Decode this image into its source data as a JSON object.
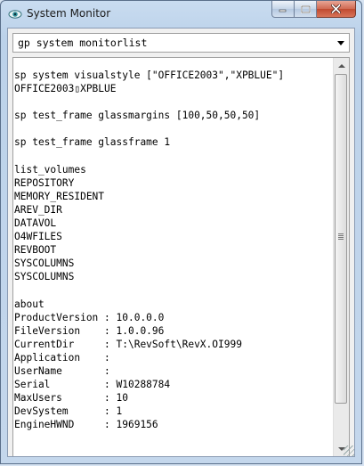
{
  "window": {
    "title": "System Monitor",
    "icon": "eye-icon"
  },
  "command": {
    "value": "gp system monitorlist"
  },
  "output": {
    "lines": [
      "sp system visualstyle [\"OFFICE2003\",\"XPBLUE\"]",
      "OFFICE2003▯XPBLUE",
      "",
      "sp test_frame glassmargins [100,50,50,50]",
      "",
      "sp test_frame glassframe 1",
      "",
      "list_volumes",
      "REPOSITORY",
      "MEMORY_RESIDENT",
      "AREV_DIR",
      "DATAVOL",
      "O4WFILES",
      "REVBOOT",
      "SYSCOLUMNS",
      "SYSCOLUMNS",
      "",
      "about",
      "ProductVersion : 10.0.0.0",
      "FileVersion    : 1.0.0.96",
      "CurrentDir     : T:\\RevSoft\\RevX.OI999",
      "Application    :",
      "UserName       :",
      "Serial         : W10288784",
      "MaxUsers       : 10",
      "DevSystem      : 1",
      "EngineHWND     : 1969156"
    ]
  },
  "colors": {
    "titlebar": "#bcd2ea",
    "close_button": "#c04a30"
  }
}
